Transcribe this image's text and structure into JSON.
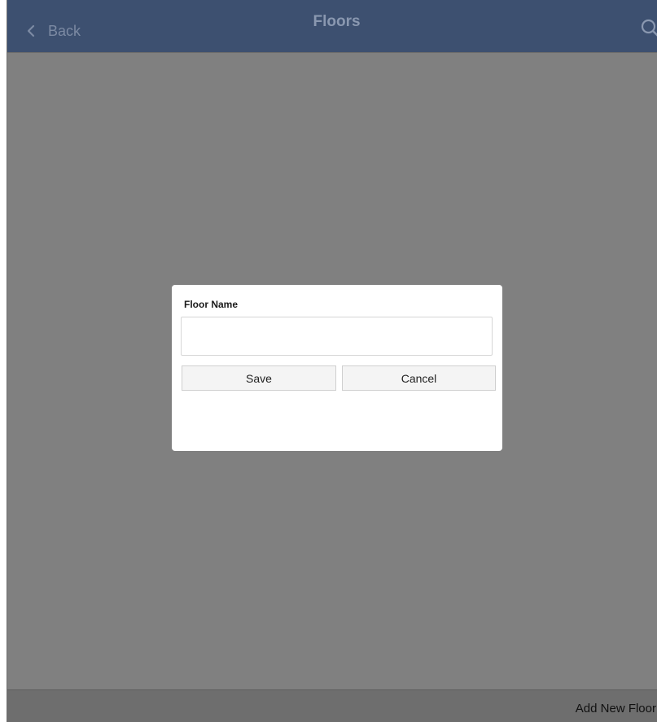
{
  "header": {
    "back_label": "Back",
    "title": "Floors",
    "back_icon": "chevron-left-icon",
    "search_icon": "search-icon"
  },
  "dialog": {
    "field_label": "Floor Name",
    "field_value": "",
    "field_placeholder": "",
    "save_label": "Save",
    "cancel_label": "Cancel"
  },
  "footer": {
    "add_label": "Add New Floor"
  },
  "colors": {
    "header_bg": "#3d5070",
    "overlay": "#808080",
    "footer_bg": "#6e6e6e",
    "dialog_bg": "#ffffff"
  }
}
